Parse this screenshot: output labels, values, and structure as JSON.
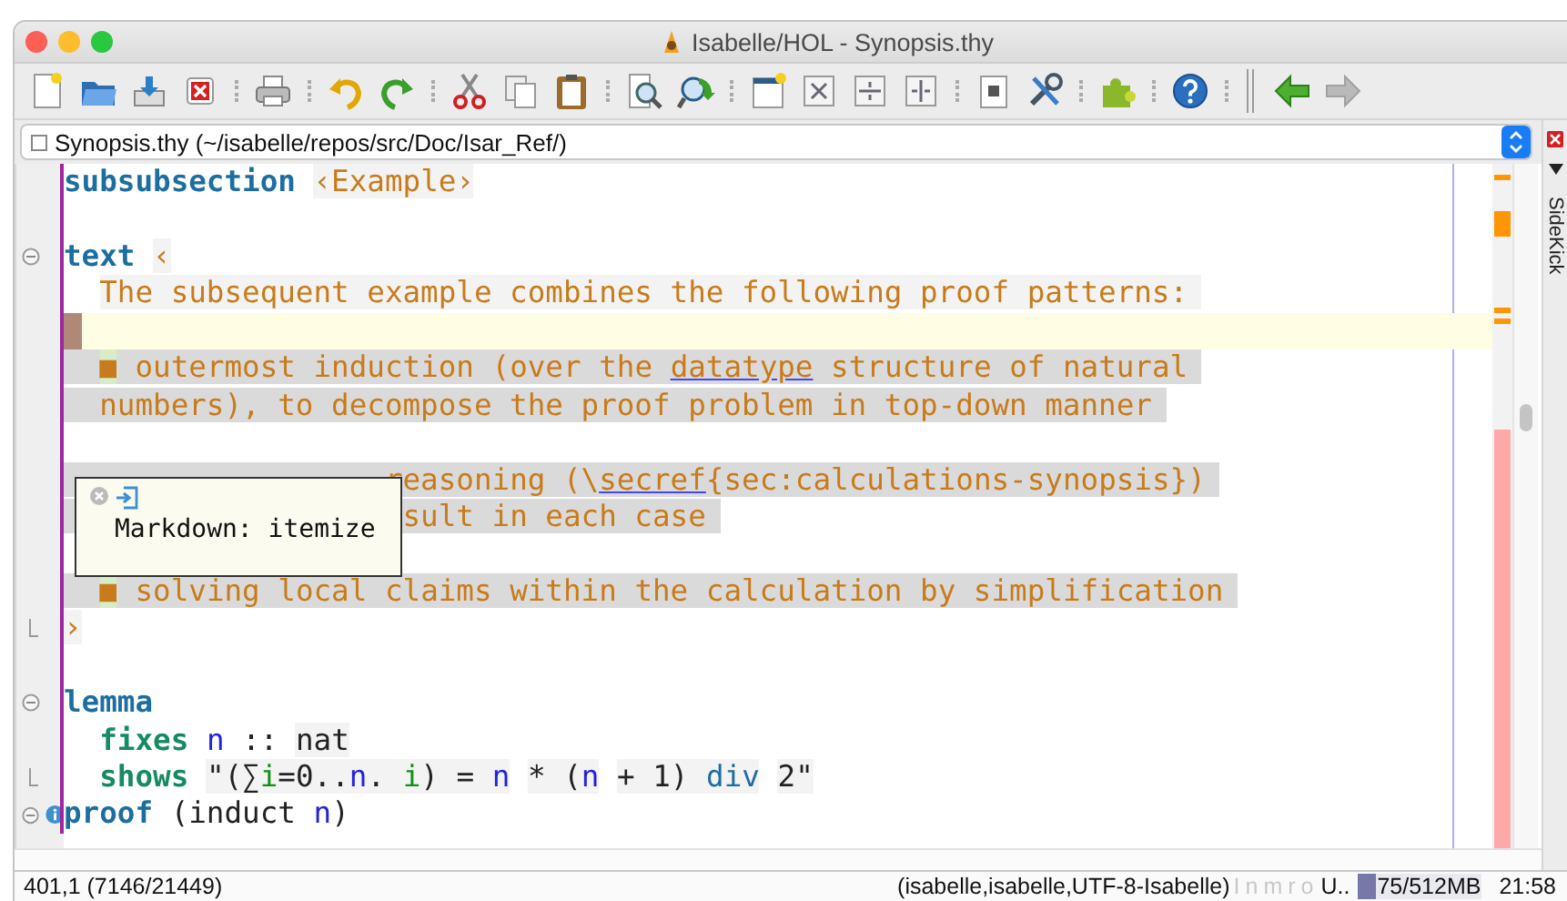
{
  "window": {
    "title": "Isabelle/HOL - Synopsis.thy"
  },
  "toolbar": [
    {
      "kind": "file",
      "items": [
        {
          "kind": "new",
          "disabled": false
        },
        {
          "kind": "open",
          "disabled": false
        },
        {
          "kind": "save",
          "disabled": false
        },
        {
          "kind": "close",
          "disabled": false
        }
      ]
    },
    {
      "kind": "file",
      "items": [
        {
          "kind": "print",
          "disabled": false
        }
      ]
    },
    {
      "kind": "file",
      "items": [
        {
          "kind": "undo",
          "disabled": false
        },
        {
          "kind": "redo",
          "disabled": false
        }
      ]
    },
    {
      "kind": "file",
      "items": [
        {
          "kind": "cut",
          "disabled": false
        },
        {
          "kind": "copy",
          "disabled": false
        },
        {
          "kind": "paste",
          "disabled": false
        }
      ]
    },
    {
      "kind": "file",
      "items": [
        {
          "kind": "find",
          "disabled": false
        },
        {
          "kind": "find-replace",
          "disabled": false
        }
      ]
    },
    {
      "kind": "file",
      "items": [
        {
          "kind": "new-view",
          "disabled": false
        },
        {
          "kind": "split-full",
          "disabled": false
        },
        {
          "kind": "split-horizontal",
          "disabled": false
        },
        {
          "kind": "split-vertical",
          "disabled": false
        }
      ]
    },
    {
      "kind": "file",
      "items": [
        {
          "kind": "page-zoom",
          "disabled": false
        },
        {
          "kind": "tools",
          "disabled": false
        }
      ]
    },
    {
      "kind": "file",
      "items": [
        {
          "kind": "plugins",
          "disabled": false
        }
      ]
    },
    {
      "kind": "file",
      "items": [
        {
          "kind": "help",
          "disabled": false
        }
      ]
    },
    {
      "kind": "navigation",
      "items": [
        {
          "kind": "back",
          "disabled": false
        },
        {
          "kind": "forward",
          "disabled": true
        }
      ]
    }
  ],
  "buffer_bar": {
    "file": "Synopsis.thy (~/isabelle/repos/src/Doc/Isar_Ref/)"
  },
  "dock": {
    "tab": "SideKick"
  },
  "editor": {
    "lines": [
      {
        "kind": "code",
        "segments": [
          {
            "kind": "keyword",
            "text": "subsubsection"
          },
          {
            "kind": "cartouche",
            "text": " ‹Example›"
          }
        ]
      },
      {
        "kind": "blank"
      },
      {
        "kind": "code",
        "gutter": {
          "kind": "fold"
        },
        "segments": [
          {
            "kind": "keyword",
            "text": "text"
          },
          {
            "kind": "cartouche",
            "text": " ‹"
          }
        ]
      },
      {
        "kind": "code",
        "segments": [
          {
            "kind": "prose-light",
            "text": "  The subsequent example combines the following proof patterns:"
          }
        ]
      },
      {
        "kind": "caret"
      },
      {
        "kind": "code",
        "segments": [
          {
            "kind": "bullet",
            "text": "  ■"
          },
          {
            "kind": "prose",
            "text": " outermost induction (over the "
          },
          {
            "kind": "link",
            "text": "datatype"
          },
          {
            "kind": "prose",
            "text": " structure of natural"
          }
        ]
      },
      {
        "kind": "code",
        "segments": [
          {
            "kind": "prose",
            "text": "  numbers), to decompose the proof problem in top-down manner"
          }
        ]
      },
      {
        "kind": "blank"
      },
      {
        "kind": "code",
        "segments": [
          {
            "kind": "prose",
            "text": "                  reasoning (\\"
          },
          {
            "kind": "link",
            "text": "secref"
          },
          {
            "kind": "prose",
            "text": "{sec:calculations-synopsis})"
          }
        ]
      },
      {
        "kind": "code",
        "segments": [
          {
            "kind": "prose",
            "text": "                   sult in each case"
          }
        ]
      },
      {
        "kind": "blank"
      },
      {
        "kind": "code",
        "segments": [
          {
            "kind": "bullet",
            "text": "  ■"
          },
          {
            "kind": "prose",
            "text": " solving local claims within the calculation by simplification"
          }
        ]
      },
      {
        "kind": "code",
        "gutter": {
          "kind": "fold-end"
        },
        "segments": [
          {
            "kind": "cartouche",
            "text": "›"
          }
        ]
      },
      {
        "kind": "blank"
      },
      {
        "kind": "code",
        "gutter": {
          "kind": "fold"
        },
        "segments": [
          {
            "kind": "keyword",
            "text": "lemma"
          }
        ]
      },
      {
        "kind": "code",
        "segments": [
          {
            "kind": "command",
            "text": "  fixes"
          },
          {
            "kind": "var",
            "text": " n"
          },
          {
            "kind": "plain",
            "text": " :: "
          },
          {
            "kind": "type",
            "text": "nat"
          }
        ]
      },
      {
        "kind": "code",
        "gutter": {
          "kind": "fold-end"
        },
        "segments": [
          {
            "kind": "command",
            "text": "  shows"
          },
          {
            "kind": "str",
            "text": " \"(∑"
          },
          {
            "kind": "str-bound",
            "text": "i"
          },
          {
            "kind": "str",
            "text": "=0.."
          },
          {
            "kind": "str-var",
            "text": "n"
          },
          {
            "kind": "str",
            "text": ". "
          },
          {
            "kind": "str-bound",
            "text": "i"
          },
          {
            "kind": "str",
            "text": ") = "
          },
          {
            "kind": "str-var",
            "text": "n"
          },
          {
            "kind": "str",
            "text": " * ("
          },
          {
            "kind": "str-var",
            "text": "n"
          },
          {
            "kind": "str",
            "text": " + 1) "
          },
          {
            "kind": "str-const",
            "text": "div"
          },
          {
            "kind": "str",
            "text": " 2\""
          }
        ]
      },
      {
        "kind": "code",
        "gutter": {
          "kind": "fold-info"
        },
        "segments": [
          {
            "kind": "keyword",
            "text": "proof"
          },
          {
            "kind": "plain",
            "text": " (induct "
          },
          {
            "kind": "var",
            "text": "n"
          },
          {
            "kind": "plain",
            "text": ")"
          }
        ]
      }
    ],
    "tooltip": {
      "text": "Markdown: itemize"
    }
  },
  "status_bar": {
    "position": "401,1 (7146/21449)",
    "mode": "(isabelle,isabelle,UTF-8-Isabelle)",
    "flags": [
      {
        "label": "I",
        "on": false
      },
      {
        "label": "n",
        "on": false
      },
      {
        "label": "m",
        "on": false
      },
      {
        "label": "r",
        "on": false
      },
      {
        "label": "o",
        "on": false
      }
    ],
    "item": "U..",
    "memory": {
      "level": 0.15,
      "reading": "75/512MB"
    },
    "clock": "21:58"
  }
}
